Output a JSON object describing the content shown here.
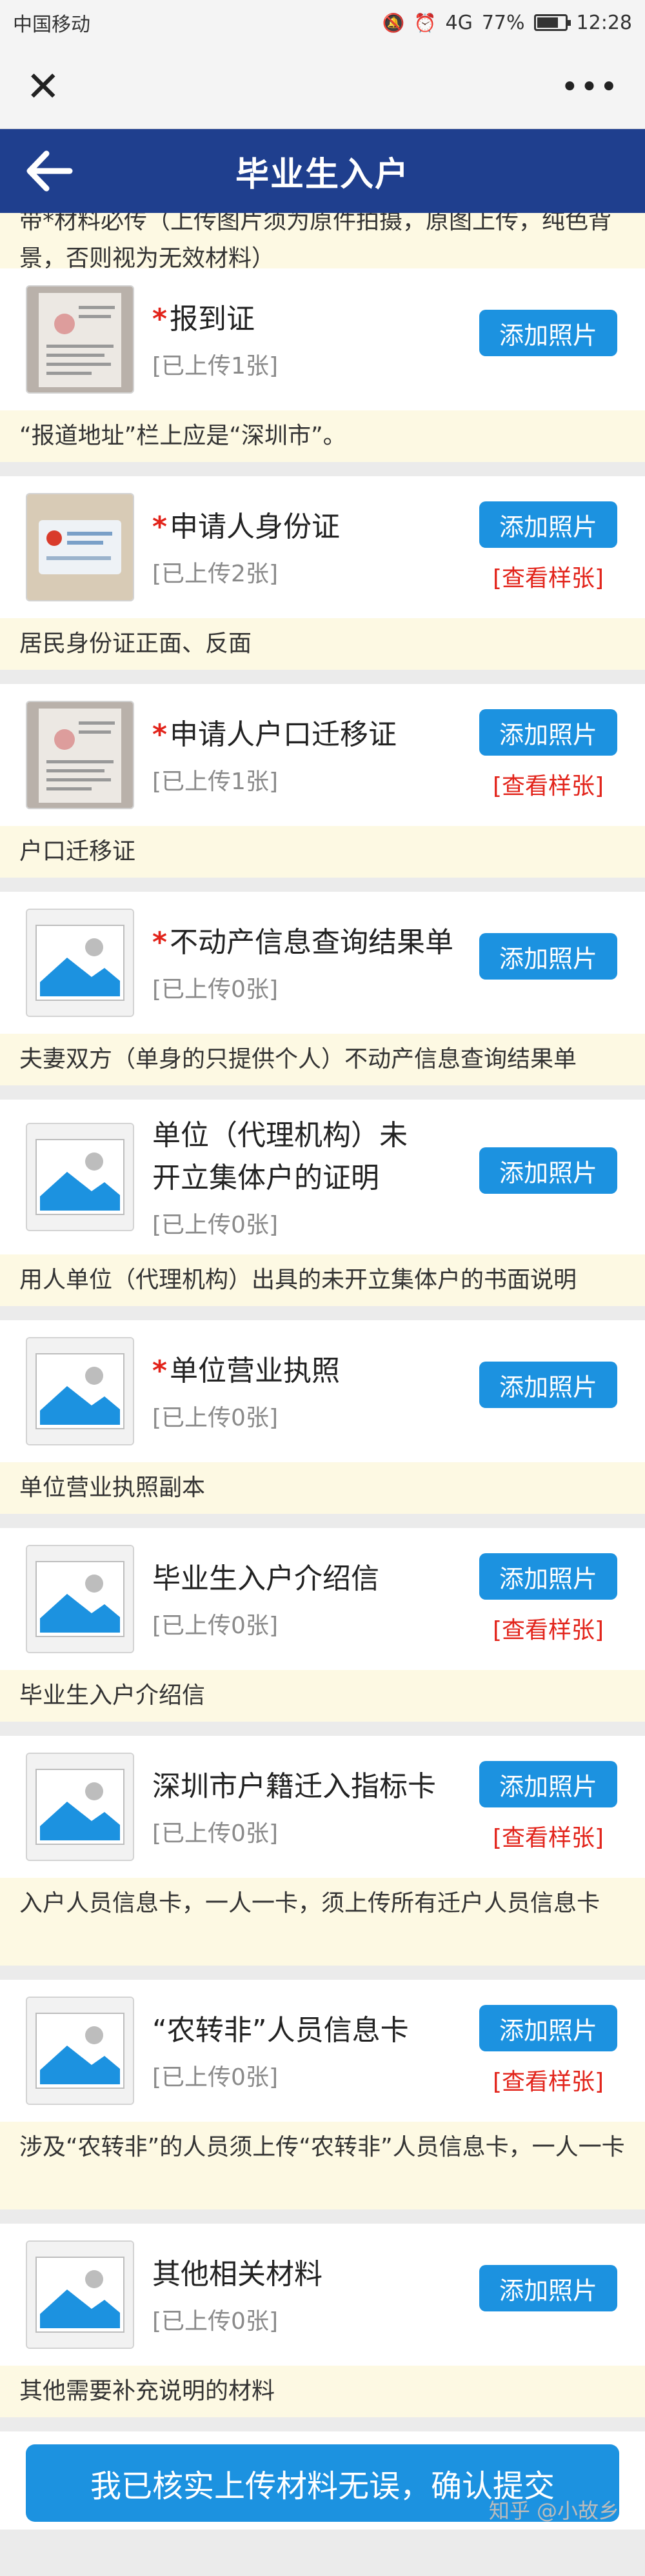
{
  "status_bar": {
    "carrier": "中国移动",
    "signal": "4G",
    "battery": "77%",
    "battery_level": 0.77,
    "time": "12:28"
  },
  "wx_bar": {
    "close": "✕",
    "more": "•••"
  },
  "header": {
    "title": "毕业生入户"
  },
  "intro": "带*材料必传（上传图片须为原件拍摄，原图上传，纯色背景，否则视为无效材料）",
  "add_label": "添加照片",
  "sample_label": "[查看样张]",
  "items": [
    {
      "name": "报到证",
      "required": "*",
      "count": "[已上传1张]",
      "note": "“报道地址”栏上应是“深圳市”。"
    },
    {
      "name": "申请人身份证",
      "required": "*",
      "count": "[已上传2张]",
      "note": "居民身份证正面、反面"
    },
    {
      "name": "申请人户口迁移证",
      "required": "*",
      "count": "[已上传1张]",
      "note": "户口迁移证"
    },
    {
      "name": "不动产信息查询结果单",
      "required": "*",
      "count": "[已上传0张]",
      "note": "夫妻双方（单身的只提供个人）不动产信息查询结果单"
    },
    {
      "name": "单位（代理机构）未开立集体户的证明",
      "required": "",
      "count": "[已上传0张]",
      "note": "用人单位（代理机构）出具的未开立集体户的书面说明"
    },
    {
      "name": "单位营业执照",
      "required": "*",
      "count": "[已上传0张]",
      "note": "单位营业执照副本"
    },
    {
      "name": "毕业生入户介绍信",
      "required": "",
      "count": "[已上传0张]",
      "note": "毕业生入户介绍信"
    },
    {
      "name": "深圳市户籍迁入指标卡",
      "required": "",
      "count": "[已上传0张]",
      "note": "入户人员信息卡，一人一卡，须上传所有迁户人员信息卡"
    },
    {
      "name": "“农转非”人员信息卡",
      "required": "",
      "count": "[已上传0张]",
      "note": "涉及“农转非”的人员须上传“农转非”人员信息卡，一人一卡"
    },
    {
      "name": "其他相关材料",
      "required": "",
      "count": "[已上传0张]",
      "note": "其他需要补充说明的材料"
    }
  ],
  "submit": {
    "label": "我已核实上传材料无误，确认提交"
  },
  "watermark": "知乎 @小故乡",
  "colors": {
    "header_bg": "#1f3f8e",
    "button_bg": "#1c92e0",
    "required": "#e2231a",
    "note_bg": "#fdf9e3"
  }
}
